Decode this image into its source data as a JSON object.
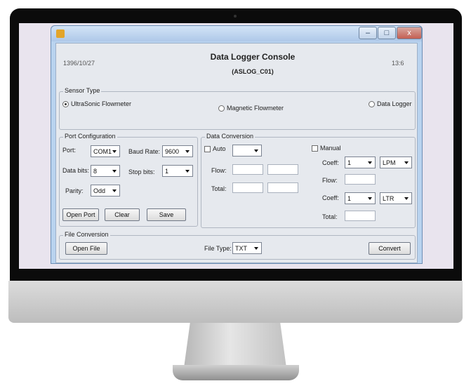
{
  "window": {
    "minimize": "–",
    "maximize": "□",
    "close": "x"
  },
  "header": {
    "date": "1396/10/27",
    "title": "Data Logger Console",
    "subtitle": "(ASLOG_C01)",
    "time": "13:6"
  },
  "sensor_type": {
    "legend": "Sensor Type",
    "options": [
      {
        "label": "UltraSonic Flowmeter",
        "selected": true
      },
      {
        "label": "Magnetic Flowmeter",
        "selected": false
      },
      {
        "label": "Data Logger",
        "selected": false
      }
    ]
  },
  "port_config": {
    "legend": "Port Configuration",
    "port_label": "Port:",
    "port_value": "COM1",
    "baud_label": "Baud Rate:",
    "baud_value": "9600",
    "databits_label": "Data bits:",
    "databits_value": "8",
    "stopbits_label": "Stop bits:",
    "stopbits_value": "1",
    "parity_label": "Parity:",
    "parity_value": "Odd",
    "open_port": "Open Port",
    "clear": "Clear",
    "save": "Save"
  },
  "data_conversion": {
    "legend": "Data Conversion",
    "auto_label": "Auto",
    "auto_value": "",
    "flow_label": "Flow:",
    "total_label": "Total:",
    "manual_label": "Manual",
    "coeff_label": "Coeff:",
    "coeff1_value": "1",
    "unit1_value": "LPM",
    "coeff2_value": "1",
    "unit2_value": "LTR"
  },
  "file_conversion": {
    "legend": "File Conversion",
    "open_file": "Open File",
    "file_type_label": "File Type:",
    "file_type_value": "TXT",
    "convert": "Convert"
  }
}
